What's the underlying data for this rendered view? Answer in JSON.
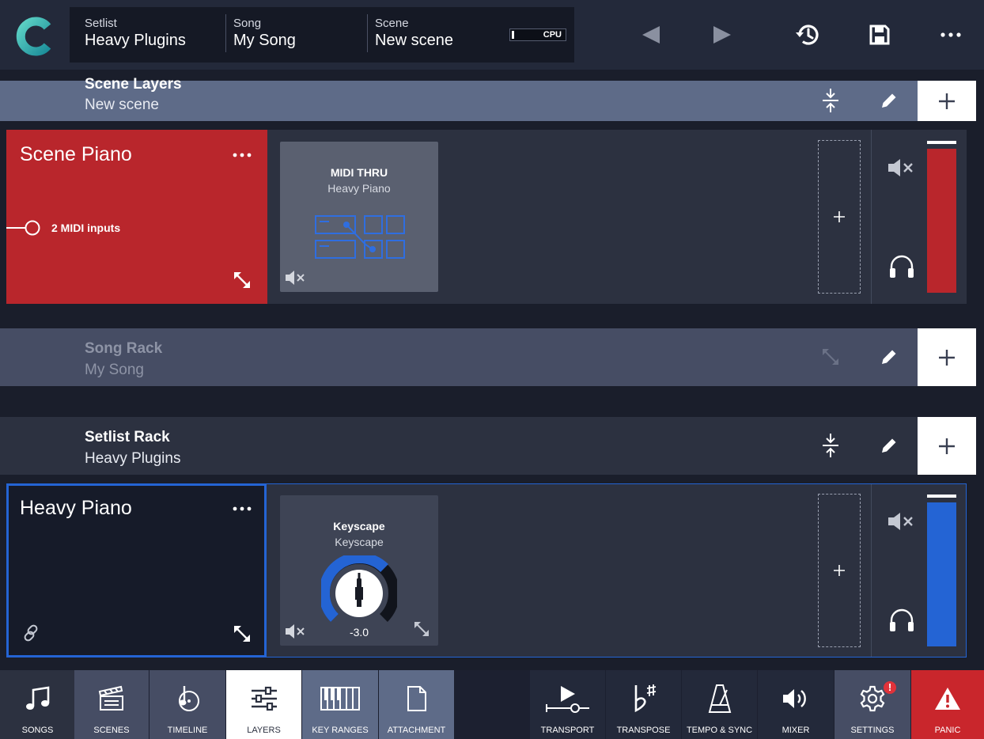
{
  "header": {
    "setlist_label": "Setlist",
    "setlist_value": "Heavy Plugins",
    "song_label": "Song",
    "song_value": "My Song",
    "scene_label": "Scene",
    "scene_value": "New scene",
    "cpu_label": "CPU"
  },
  "scene_layers": {
    "title": "Scene Layers",
    "subtitle": "New scene"
  },
  "scene_layer": {
    "name": "Scene Piano",
    "midi_inputs": "2 MIDI inputs",
    "color": "#b9262c",
    "plugin": {
      "title": "MIDI THRU",
      "subtitle": "Heavy Piano"
    }
  },
  "song_rack": {
    "title": "Song Rack",
    "subtitle": "My Song"
  },
  "setlist_rack": {
    "title": "Setlist Rack",
    "subtitle": "Heavy Plugins"
  },
  "setlist_layer": {
    "name": "Heavy Piano",
    "color": "#2464d4",
    "plugin": {
      "title": "Keyscape",
      "subtitle": "Keyscape",
      "knob_value": "-3.0"
    }
  },
  "tabs": [
    {
      "label": "SONGS"
    },
    {
      "label": "SCENES"
    },
    {
      "label": "TIMELINE"
    },
    {
      "label": "LAYERS"
    },
    {
      "label": "KEY RANGES"
    },
    {
      "label": "ATTACHMENT"
    },
    {
      "label": "TRANSPORT"
    },
    {
      "label": "TRANSPOSE"
    },
    {
      "label": "TEMPO & SYNC"
    },
    {
      "label": "MIXER"
    },
    {
      "label": "SETTINGS"
    },
    {
      "label": "PANIC"
    }
  ],
  "settings_badge": "!",
  "colors": {
    "accent_red": "#b9262c",
    "accent_blue": "#2464d4",
    "logo_teal": "#2ab6b0"
  }
}
